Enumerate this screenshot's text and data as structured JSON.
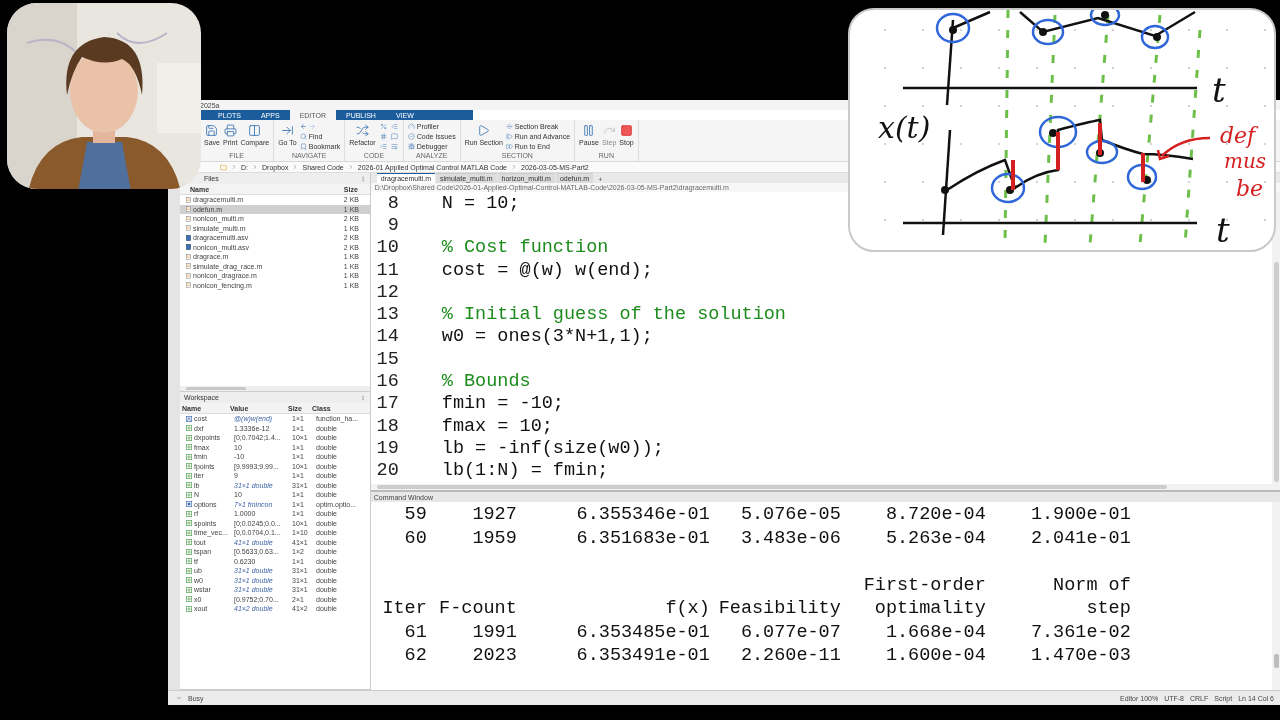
{
  "window": {
    "title": "2025a"
  },
  "ribbon_tabs": [
    {
      "label": "PLOTS",
      "selected": false
    },
    {
      "label": "APPS",
      "selected": false
    },
    {
      "label": "EDITOR",
      "selected": true
    },
    {
      "label": "PUBLISH",
      "selected": false
    },
    {
      "label": "VIEW",
      "selected": false
    }
  ],
  "ribbon_groups": [
    {
      "label": "FILE",
      "items": [
        {
          "kind": "large",
          "label": "Save",
          "disabled": false
        },
        {
          "kind": "large",
          "label": "Print",
          "disabled": false
        },
        {
          "kind": "large",
          "label": "Compare",
          "disabled": false
        }
      ]
    },
    {
      "label": "NAVIGATE",
      "items": [
        {
          "kind": "large",
          "label": "Go To",
          "disabled": false
        },
        {
          "kind": "arrows",
          "disabled": false
        },
        {
          "kind": "small",
          "label": "Find",
          "disabled": false
        },
        {
          "kind": "small",
          "label": "Bookmark",
          "disabled": false
        }
      ]
    },
    {
      "label": "CODE",
      "items": [
        {
          "kind": "large",
          "label": "Refactor",
          "disabled": false
        },
        {
          "kind": "icon",
          "disabled": false
        },
        {
          "kind": "icon",
          "disabled": false
        },
        {
          "kind": "icon",
          "disabled": false
        },
        {
          "kind": "icon",
          "disabled": false
        },
        {
          "kind": "icon",
          "disabled": false
        },
        {
          "kind": "icon",
          "disabled": false
        }
      ]
    },
    {
      "label": "ANALYZE",
      "items": [
        {
          "kind": "small",
          "label": "Profiler",
          "disabled": false
        },
        {
          "kind": "small",
          "label": "Code Issues",
          "disabled": false
        },
        {
          "kind": "small",
          "label": "Debugger",
          "disabled": false
        }
      ]
    },
    {
      "label": "SECTION",
      "items": [
        {
          "kind": "large",
          "label": "Run Section",
          "disabled": false
        },
        {
          "kind": "small",
          "label": "Section Break",
          "disabled": false
        },
        {
          "kind": "small",
          "label": "Run and Advance",
          "disabled": false
        },
        {
          "kind": "small",
          "label": "Run to End",
          "disabled": false
        }
      ]
    },
    {
      "label": "RUN",
      "items": [
        {
          "kind": "large",
          "label": "Pause",
          "disabled": false
        },
        {
          "kind": "large",
          "label": "Step",
          "disabled": true
        },
        {
          "kind": "large",
          "label": "Stop",
          "disabled": false
        }
      ]
    }
  ],
  "address": [
    "D:",
    "Dropbox",
    "Shared Code",
    "2026-01 Applied Optimal Control MATLAB Code",
    "2026-03-05-MS-Part2"
  ],
  "files": {
    "title": "Files",
    "columns": [
      "Name",
      "Size"
    ],
    "rows": [
      {
        "kind": "script",
        "name": "dragracemulti.m",
        "size": "2 KB",
        "selected": false
      },
      {
        "kind": "script",
        "name": "odefun.m",
        "size": "1 KB",
        "selected": true
      },
      {
        "kind": "script",
        "name": "nonlcon_multi.m",
        "size": "2 KB",
        "selected": false
      },
      {
        "kind": "script",
        "name": "simulate_multi.m",
        "size": "1 KB",
        "selected": false
      },
      {
        "kind": "autosave",
        "name": "dragracemulti.asv",
        "size": "2 KB",
        "selected": false
      },
      {
        "kind": "autosave",
        "name": "nonlcon_multi.asv",
        "size": "2 KB",
        "selected": false
      },
      {
        "kind": "script",
        "name": "dragrace.m",
        "size": "1 KB",
        "selected": false
      },
      {
        "kind": "script",
        "name": "simulate_drag_race.m",
        "size": "1 KB",
        "selected": false
      },
      {
        "kind": "script",
        "name": "nonlcon_dragrace.m",
        "size": "1 KB",
        "selected": false
      },
      {
        "kind": "script",
        "name": "nonlcon_fencing.m",
        "size": "1 KB",
        "selected": false
      }
    ]
  },
  "workspace": {
    "title": "Workspace",
    "columns": [
      "Name",
      "Value",
      "Size",
      "Class"
    ],
    "rows": [
      {
        "kind": "function",
        "name": "cost",
        "value": "@(w)w(end)",
        "summary": true,
        "size": "1×1",
        "class": "function_ha..."
      },
      {
        "kind": "array",
        "name": "dxf",
        "value": "1.3336e-12",
        "summary": false,
        "size": "1×1",
        "class": "double"
      },
      {
        "kind": "array",
        "name": "dxpoints",
        "value": "[0;0.7042;1.4...",
        "summary": false,
        "size": "10×1",
        "class": "double"
      },
      {
        "kind": "array",
        "name": "fmax",
        "value": "10",
        "summary": false,
        "size": "1×1",
        "class": "double"
      },
      {
        "kind": "array",
        "name": "fmin",
        "value": "-10",
        "summary": false,
        "size": "1×1",
        "class": "double"
      },
      {
        "kind": "array",
        "name": "fpoints",
        "value": "[9.9993;9.99...",
        "summary": false,
        "size": "10×1",
        "class": "double"
      },
      {
        "kind": "array",
        "name": "iter",
        "value": "9",
        "summary": false,
        "size": "1×1",
        "class": "double"
      },
      {
        "kind": "array",
        "name": "lb",
        "value": "31×1 double",
        "summary": true,
        "size": "31×1",
        "class": "double"
      },
      {
        "kind": "array",
        "name": "N",
        "value": "10",
        "summary": false,
        "size": "1×1",
        "class": "double"
      },
      {
        "kind": "object",
        "name": "options",
        "value": "7×1 fmincon",
        "summary": true,
        "size": "1×1",
        "class": "optim.optio..."
      },
      {
        "kind": "array",
        "name": "rf",
        "value": "1.0000",
        "summary": false,
        "size": "1×1",
        "class": "double"
      },
      {
        "kind": "array",
        "name": "spoints",
        "value": "[0;0.0245;0.0...",
        "summary": false,
        "size": "10×1",
        "class": "double"
      },
      {
        "kind": "array",
        "name": "time_vec...",
        "value": "[0,0.0704,0.1...",
        "summary": false,
        "size": "1×10",
        "class": "double"
      },
      {
        "kind": "array",
        "name": "tout",
        "value": "41×1 double",
        "summary": true,
        "size": "41×1",
        "class": "double"
      },
      {
        "kind": "array",
        "name": "tspan",
        "value": "[0.5633,0.63...",
        "summary": false,
        "size": "1×2",
        "class": "double"
      },
      {
        "kind": "array",
        "name": "tf",
        "value": "0.6230",
        "summary": false,
        "size": "1×1",
        "class": "double"
      },
      {
        "kind": "array",
        "name": "ub",
        "value": "31×1 double",
        "summary": true,
        "size": "31×1",
        "class": "double"
      },
      {
        "kind": "array",
        "name": "w0",
        "value": "31×1 double",
        "summary": true,
        "size": "31×1",
        "class": "double"
      },
      {
        "kind": "array",
        "name": "wstar",
        "value": "31×1 double",
        "summary": true,
        "size": "31×1",
        "class": "double"
      },
      {
        "kind": "array",
        "name": "x0",
        "value": "[0.9752;0.70...",
        "summary": false,
        "size": "2×1",
        "class": "double"
      },
      {
        "kind": "array",
        "name": "xout",
        "value": "41×2 double",
        "summary": true,
        "size": "41×2",
        "class": "double"
      }
    ]
  },
  "editor": {
    "tabs": [
      {
        "label": "dragracemulti.m",
        "selected": true
      },
      {
        "label": "simulate_multi.m",
        "selected": false
      },
      {
        "label": "horizon_multi.m",
        "selected": false
      },
      {
        "label": "odefun.m",
        "selected": false
      }
    ],
    "new_tab": "+",
    "path": "D:\\Dropbox\\Shared Code\\2026-01-Applied-Optimal-Control-MATLAB-Code\\2026-03-05-MS-Part2\\dragracemulti.m",
    "lines": [
      {
        "num": "8",
        "kind": "code",
        "text": "N = 10;"
      },
      {
        "num": "9"
      },
      {
        "num": "10",
        "kind": "comment",
        "text": "% Cost function"
      },
      {
        "num": "11",
        "kind": "code",
        "text": "cost = @(w) w(end);"
      },
      {
        "num": "12"
      },
      {
        "num": "13",
        "kind": "comment",
        "text": "% Initial guess of the solution"
      },
      {
        "num": "14",
        "kind": "code",
        "text": "w0 = ones(3*N+1,1);"
      },
      {
        "num": "15"
      },
      {
        "num": "16",
        "kind": "comment",
        "text": "% Bounds"
      },
      {
        "num": "17",
        "kind": "code",
        "text": "fmin = -10;"
      },
      {
        "num": "18",
        "kind": "code",
        "text": "fmax = 10;"
      },
      {
        "num": "19",
        "kind": "code",
        "text": "lb = -inf(size(w0));"
      },
      {
        "num": "20",
        "kind": "code",
        "text": "lb(1:N) = fmin;"
      }
    ]
  },
  "command_window": {
    "title": "Command Window",
    "rows": [
      {
        "kind": "data",
        "cells": [
          "59",
          "1927",
          "6.355346e-01",
          "5.076e-05",
          "8.720e-04",
          "1.900e-01"
        ]
      },
      {
        "kind": "data",
        "cells": [
          "60",
          "1959",
          "6.351683e-01",
          "3.483e-06",
          "5.263e-04",
          "2.041e-01"
        ]
      },
      {
        "kind": "blank"
      },
      {
        "kind": "header",
        "cells": [
          "",
          "",
          "",
          "",
          "First-order",
          "Norm of"
        ]
      },
      {
        "kind": "header",
        "cells": [
          "Iter",
          "F-count",
          "f(x)",
          "Feasibility",
          "optimality",
          "step"
        ]
      },
      {
        "kind": "data",
        "cells": [
          "61",
          "1991",
          "6.353485e-01",
          "6.077e-07",
          "1.668e-04",
          "7.361e-02"
        ]
      },
      {
        "kind": "data",
        "cells": [
          "62",
          "2023",
          "6.353491e-01",
          "2.260e-11",
          "1.600e-04",
          "1.470e-03"
        ]
      }
    ]
  },
  "status_bar": {
    "state": "Busy",
    "items": [
      "Editor 100%",
      "UTF-8",
      "CRLF",
      "Script",
      "Ln 14 Col 6"
    ]
  },
  "sketch": {
    "labels": [
      {
        "kind": "axis",
        "text": "t"
      },
      {
        "kind": "axis",
        "text": "x(t)"
      },
      {
        "kind": "note",
        "text": "def"
      },
      {
        "kind": "note",
        "text": "mus"
      },
      {
        "kind": "note",
        "text": "be"
      },
      {
        "kind": "axis",
        "text": "t"
      }
    ]
  }
}
